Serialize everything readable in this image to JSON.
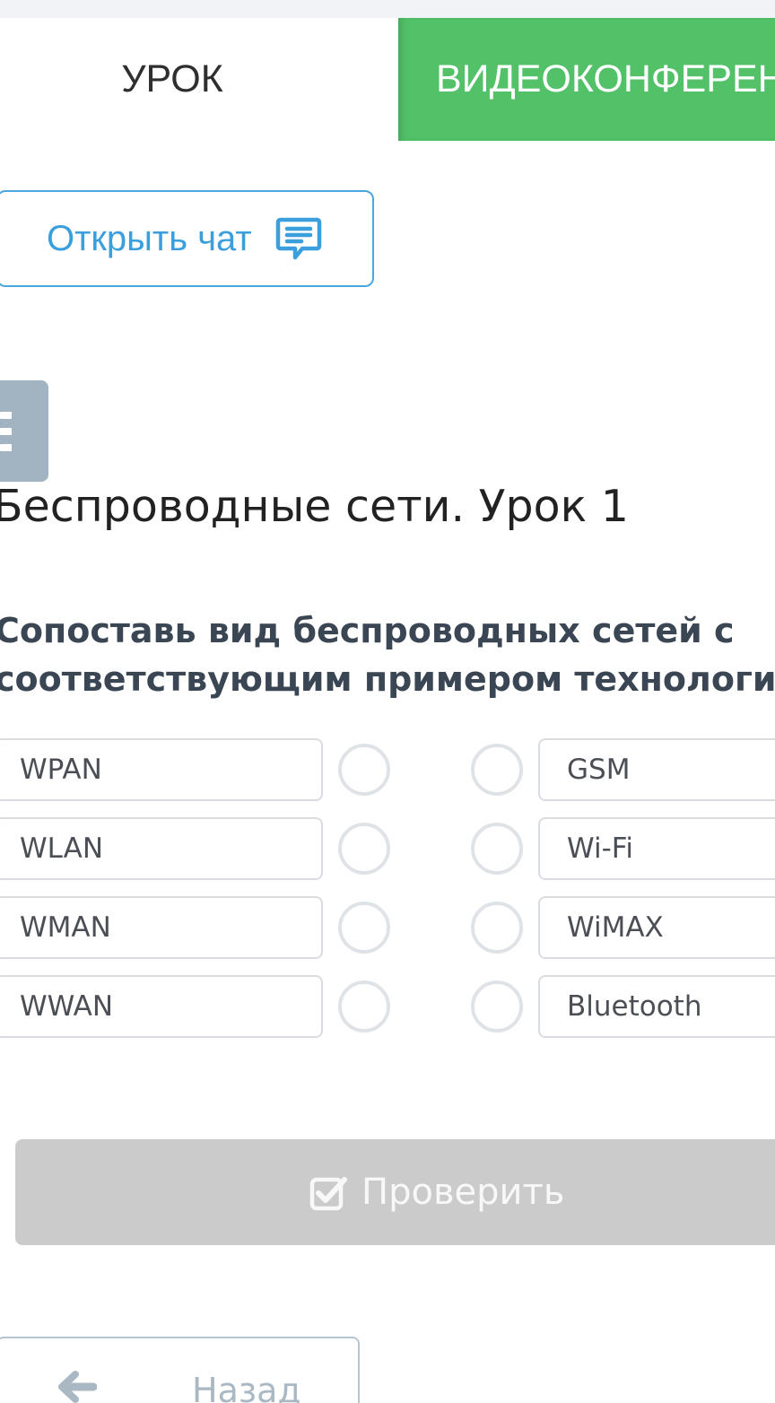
{
  "tabs": {
    "lesson": "УРОК",
    "video": "ВИДЕОКОНФЕРЕНЦИЯ"
  },
  "chat": {
    "label": "Открыть чат",
    "icon": "chat-bubble-icon"
  },
  "menu": {
    "icon": "hamburger-menu-icon"
  },
  "lesson_title": "Беспроводные сети. Урок 1",
  "question": {
    "line1": "Сопоставь вид беспроводных сетей с",
    "line2": "соответствующим примером технологий"
  },
  "matching": {
    "left": [
      "WPAN",
      "WLAN",
      "WMAN",
      "WWAN"
    ],
    "right": [
      "GSM",
      "Wi-Fi",
      "WiMAX",
      "Bluetooth"
    ]
  },
  "check_button": {
    "label": "Проверить",
    "icon": "checkbox-check-icon"
  },
  "back_button": {
    "label": "Назад",
    "icon": "arrow-left-icon"
  },
  "colors": {
    "accent_green": "#52c168",
    "link_blue": "#3a9fdc",
    "menu_gray": "#a2b4c2",
    "button_disabled": "#cbcbcb"
  }
}
